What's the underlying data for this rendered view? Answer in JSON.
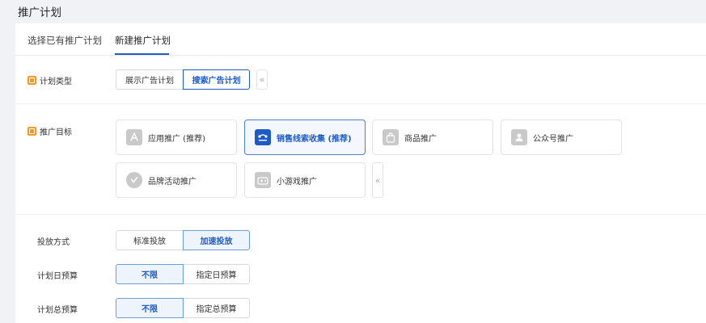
{
  "page": {
    "title": "推广计划"
  },
  "tabs": [
    {
      "label": "选择已有推广计划"
    },
    {
      "label": "新建推广计划"
    }
  ],
  "plan_type": {
    "label": "计划类型",
    "options": [
      "展示广告计划",
      "搜索广告计划"
    ],
    "selected": "搜索广告计划",
    "collapse": "«"
  },
  "promo_goal": {
    "label": "推广目标",
    "options": [
      {
        "label": "应用推广 (推荐)",
        "icon": "app-store-icon"
      },
      {
        "label": "销售线索收集 (推荐)",
        "icon": "lead-collection-icon"
      },
      {
        "label": "商品推广",
        "icon": "shopping-bag-icon"
      },
      {
        "label": "公众号推广",
        "icon": "official-account-icon"
      },
      {
        "label": "品牌活动推广",
        "icon": "brand-check-icon"
      },
      {
        "label": "小游戏推广",
        "icon": "gamepad-icon"
      }
    ],
    "selected": "销售线索收集 (推荐)",
    "collapse": "«"
  },
  "delivery_method": {
    "label": "投放方式",
    "options": [
      "标准投放",
      "加速投放"
    ],
    "selected": "加速投放"
  },
  "daily_budget": {
    "label": "计划日预算",
    "options": [
      "不限",
      "指定日预算"
    ],
    "selected": "不限"
  },
  "total_budget": {
    "label": "计划总预算",
    "options": [
      "不限",
      "指定总预算"
    ],
    "selected": "不限"
  },
  "colors": {
    "accent": "#1e5bc6",
    "badge": "#f29b22"
  }
}
